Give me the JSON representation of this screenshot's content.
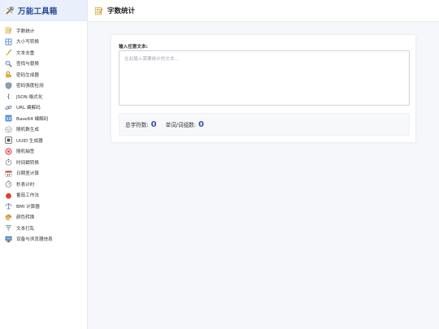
{
  "app": {
    "title": "万能工具箱",
    "icon": "tools-icon"
  },
  "sidebar": {
    "items": [
      {
        "label": "字数统计",
        "icon": "memo-icon",
        "active": true
      },
      {
        "label": "大小写转换",
        "icon": "number-keys-icon"
      },
      {
        "label": "文本去重",
        "icon": "broom-icon"
      },
      {
        "label": "查找与替换",
        "icon": "magnifier-icon"
      },
      {
        "label": "密码生成器",
        "icon": "lock-key-icon"
      },
      {
        "label": "密码强度检测",
        "icon": "shield-icon"
      },
      {
        "label": "JSON 格式化",
        "icon": "braces-icon"
      },
      {
        "label": "URL 编解码",
        "icon": "link-icon"
      },
      {
        "label": "Base64 编解码",
        "icon": "numbers-icon"
      },
      {
        "label": "随机数生成",
        "icon": "dice-icon"
      },
      {
        "label": "UUID 生成器",
        "icon": "id-icon"
      },
      {
        "label": "随机抽签",
        "icon": "target-icon"
      },
      {
        "label": "时间戳转换",
        "icon": "stopwatch-icon"
      },
      {
        "label": "日期差计算",
        "icon": "calendar-icon"
      },
      {
        "label": "秒表计时",
        "icon": "timer-icon"
      },
      {
        "label": "番茄工作法",
        "icon": "tomato-icon"
      },
      {
        "label": "BMI 计算器",
        "icon": "scales-icon"
      },
      {
        "label": "颜色转换",
        "icon": "palette-icon"
      },
      {
        "label": "文本打乱",
        "icon": "tornado-icon"
      },
      {
        "label": "设备与浏览器信息",
        "icon": "monitor-icon"
      }
    ]
  },
  "header": {
    "title": "字数统计",
    "icon": "memo-icon"
  },
  "main": {
    "input_label": "输入任意文本:",
    "input_placeholder": "在此输入需要统计的文本...",
    "input_value": "",
    "stats": {
      "total_chars_label": "总字符数:",
      "total_chars_value": "0",
      "words_label": "单词/词组数:",
      "words_value": "0"
    }
  },
  "colors": {
    "accent": "#3b53a8",
    "brand_bg": "#e9effb",
    "brand_text": "#2b4a9c",
    "page_bg": "#f6f7fb"
  }
}
